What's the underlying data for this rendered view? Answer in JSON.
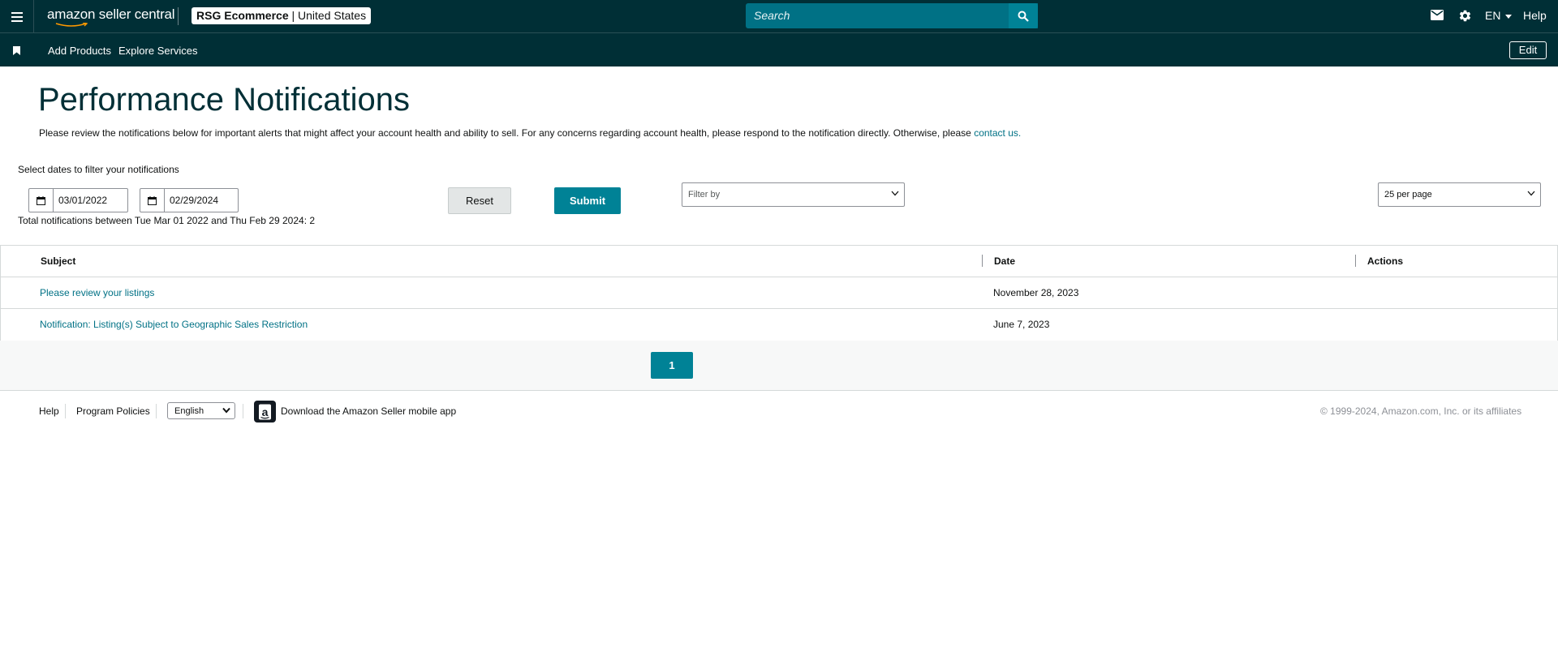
{
  "header": {
    "logo_text": "amazon seller central",
    "account_name": "RSG Ecommerce",
    "account_region": "| United States",
    "search_placeholder": "Search",
    "language": "EN",
    "help_label": "Help"
  },
  "nav": {
    "items": [
      {
        "label": "Add Products"
      },
      {
        "label": "Explore Services"
      }
    ],
    "edit_label": "Edit"
  },
  "page": {
    "title": "Performance Notifications",
    "intro_text": "Please review the notifications below for important alerts that might affect your account health and ability to sell. For any concerns regarding account health, please respond to the notification directly. Otherwise, please",
    "intro_link": "contact us.",
    "filter_label": "Select dates to filter your notifications",
    "start_date": "03/01/2022",
    "end_date": "02/29/2024",
    "total_text": "Total notifications between Tue Mar 01 2022 and Thu Feb 29 2024: 2",
    "reset_label": "Reset",
    "submit_label": "Submit",
    "filter_placeholder": "Filter by",
    "per_page_value": "25 per page"
  },
  "table": {
    "headers": {
      "subject": "Subject",
      "date": "Date",
      "actions": "Actions"
    },
    "rows": [
      {
        "subject": "Please review your listings",
        "date": "November 28, 2023"
      },
      {
        "subject": "Notification: Listing(s) Subject to Geographic Sales Restriction",
        "date": "June 7, 2023"
      }
    ]
  },
  "pager": {
    "current_page": "1"
  },
  "footer": {
    "help_label": "Help",
    "policies_label": "Program Policies",
    "language_value": "English",
    "app_text": "Download the Amazon Seller mobile app",
    "copyright": "© 1999-2024, Amazon.com, Inc. or its affiliates"
  },
  "colors": {
    "header_bg": "#002f36",
    "accent": "#008296",
    "link": "#007185"
  },
  "icons": {
    "menu": "hamburger-icon",
    "search": "search-icon",
    "mail": "mail-icon",
    "settings": "gear-icon",
    "bookmark": "bookmark-icon",
    "calendar": "calendar-icon",
    "chevron": "chevron-down-icon",
    "app": "amazon-app-icon"
  }
}
